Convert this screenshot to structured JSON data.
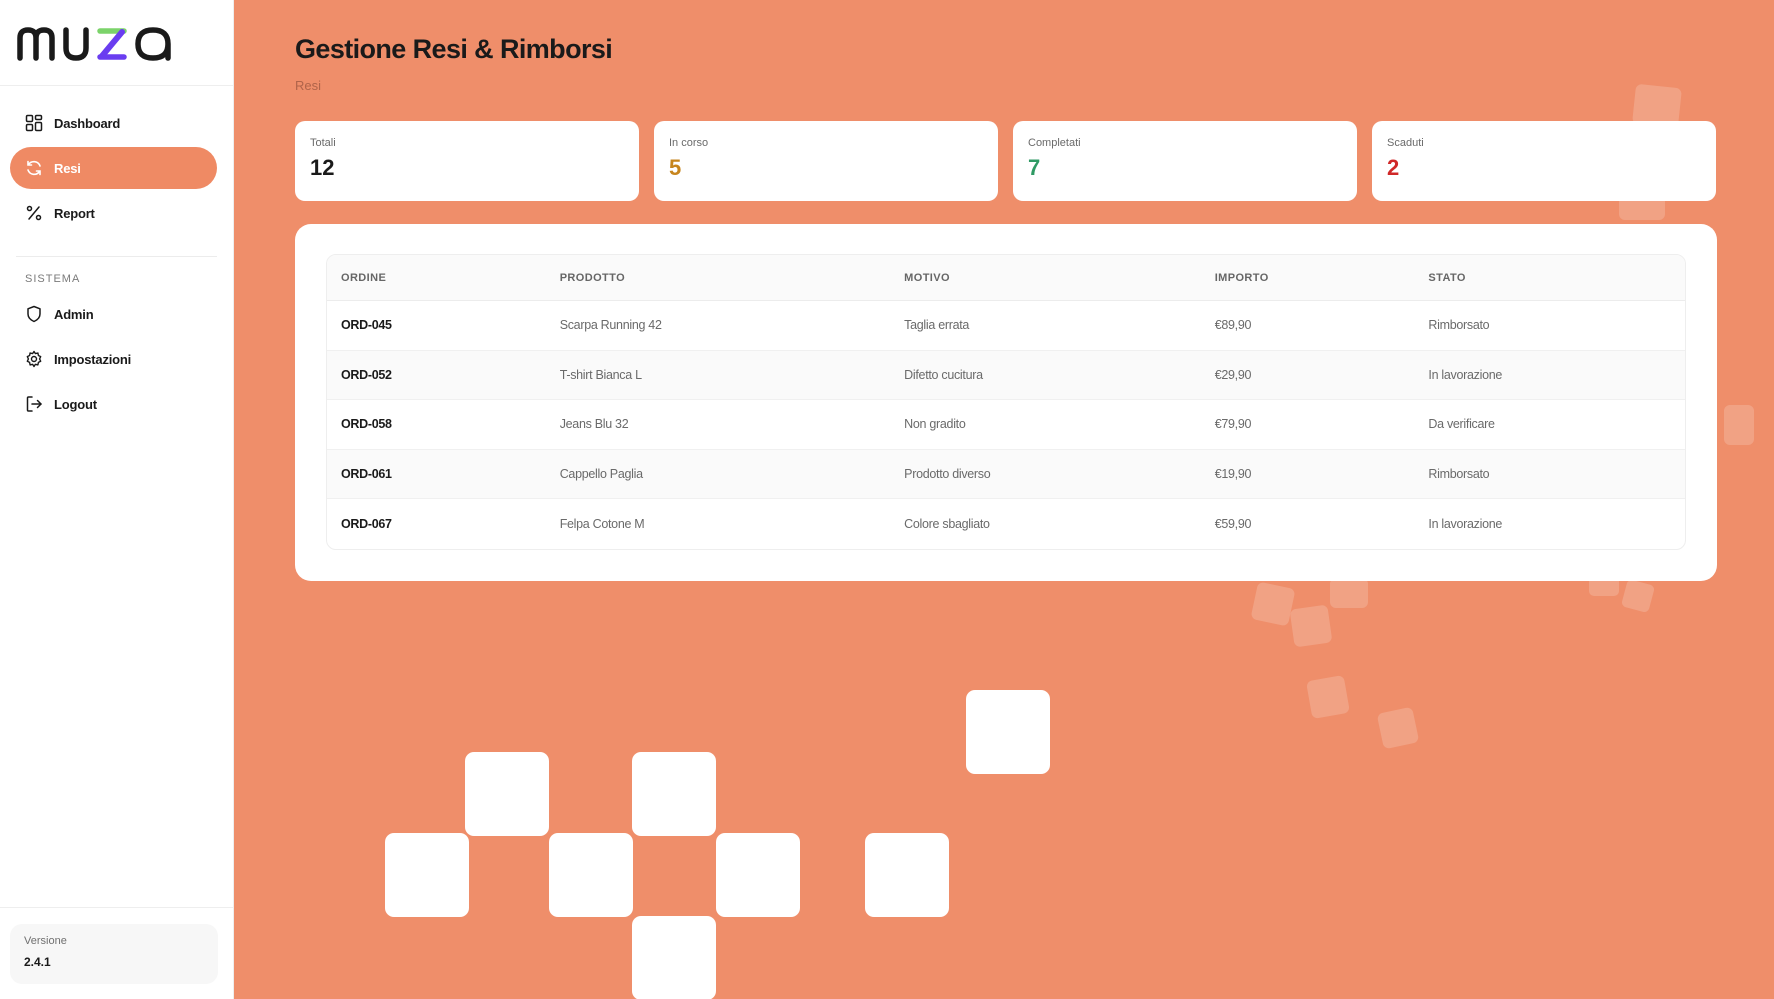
{
  "brand": {
    "name": "muza",
    "colors": {
      "dark": "#1a1a1a",
      "green": "#7bd36a",
      "purple": "#6a3df0"
    }
  },
  "sidebar": {
    "items": [
      {
        "label": "Dashboard",
        "icon": "grid-icon",
        "active": false
      },
      {
        "label": "Resi",
        "icon": "refresh-icon",
        "active": true
      },
      {
        "label": "Report",
        "icon": "percent-icon",
        "active": false
      }
    ],
    "section_title": "SISTEMA",
    "system_items": [
      {
        "label": "Admin",
        "icon": "shield-icon"
      },
      {
        "label": "Impostazioni",
        "icon": "gear-icon"
      },
      {
        "label": "Logout",
        "icon": "logout-icon"
      }
    ],
    "version_label": "Versione",
    "version_value": "2.4.1"
  },
  "header": {
    "title": "Gestione Resi & Rimborsi",
    "breadcrumb": "Resi"
  },
  "stats": [
    {
      "label": "Totali",
      "value": "12",
      "color": "#1a1a1a"
    },
    {
      "label": "In corso",
      "value": "5",
      "color": "#c7851d"
    },
    {
      "label": "Completati",
      "value": "7",
      "color": "#2f9a64"
    },
    {
      "label": "Scaduti",
      "value": "2",
      "color": "#d02828"
    }
  ],
  "table": {
    "headers": [
      "ORDINE",
      "PRODOTTO",
      "MOTIVO",
      "IMPORTO",
      "STATO"
    ],
    "rows": [
      [
        "ORD-045",
        "Scarpa Running 42",
        "Taglia errata",
        "€89,90",
        "Rimborsato"
      ],
      [
        "ORD-052",
        "T-shirt Bianca L",
        "Difetto cucitura",
        "€29,90",
        "In lavorazione"
      ],
      [
        "ORD-058",
        "Jeans Blu 32",
        "Non gradito",
        "€79,90",
        "Da verificare"
      ],
      [
        "ORD-061",
        "Cappello Paglia",
        "Prodotto diverso",
        "€19,90",
        "Rimborsato"
      ],
      [
        "ORD-067",
        "Felpa Cotone M",
        "Colore sbagliato",
        "€59,90",
        "In lavorazione"
      ]
    ]
  },
  "theme": {
    "accent": "#ef8e6a",
    "active_nav": "#ef8a64"
  }
}
